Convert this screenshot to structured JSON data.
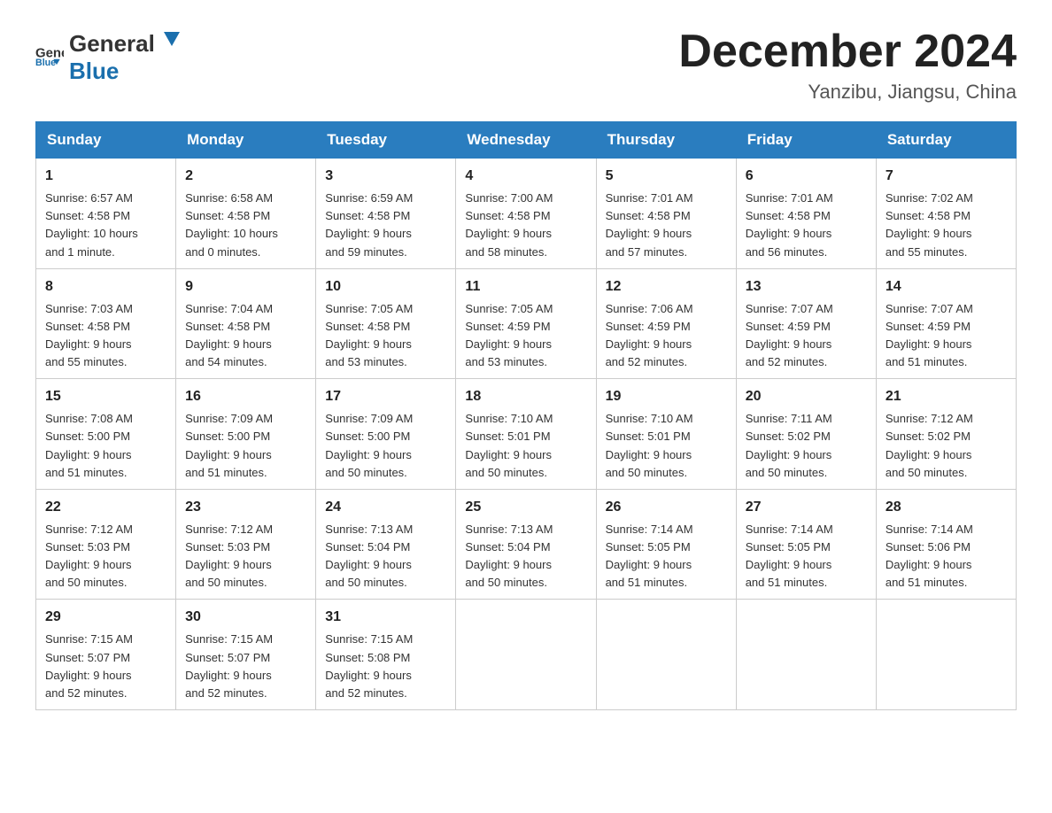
{
  "logo": {
    "text_general": "General",
    "text_blue": "Blue"
  },
  "title": "December 2024",
  "location": "Yanzibu, Jiangsu, China",
  "days_of_week": [
    "Sunday",
    "Monday",
    "Tuesday",
    "Wednesday",
    "Thursday",
    "Friday",
    "Saturday"
  ],
  "weeks": [
    [
      {
        "day": "1",
        "sunrise": "6:57 AM",
        "sunset": "4:58 PM",
        "daylight": "10 hours and 1 minute."
      },
      {
        "day": "2",
        "sunrise": "6:58 AM",
        "sunset": "4:58 PM",
        "daylight": "10 hours and 0 minutes."
      },
      {
        "day": "3",
        "sunrise": "6:59 AM",
        "sunset": "4:58 PM",
        "daylight": "9 hours and 59 minutes."
      },
      {
        "day": "4",
        "sunrise": "7:00 AM",
        "sunset": "4:58 PM",
        "daylight": "9 hours and 58 minutes."
      },
      {
        "day": "5",
        "sunrise": "7:01 AM",
        "sunset": "4:58 PM",
        "daylight": "9 hours and 57 minutes."
      },
      {
        "day": "6",
        "sunrise": "7:01 AM",
        "sunset": "4:58 PM",
        "daylight": "9 hours and 56 minutes."
      },
      {
        "day": "7",
        "sunrise": "7:02 AM",
        "sunset": "4:58 PM",
        "daylight": "9 hours and 55 minutes."
      }
    ],
    [
      {
        "day": "8",
        "sunrise": "7:03 AM",
        "sunset": "4:58 PM",
        "daylight": "9 hours and 55 minutes."
      },
      {
        "day": "9",
        "sunrise": "7:04 AM",
        "sunset": "4:58 PM",
        "daylight": "9 hours and 54 minutes."
      },
      {
        "day": "10",
        "sunrise": "7:05 AM",
        "sunset": "4:58 PM",
        "daylight": "9 hours and 53 minutes."
      },
      {
        "day": "11",
        "sunrise": "7:05 AM",
        "sunset": "4:59 PM",
        "daylight": "9 hours and 53 minutes."
      },
      {
        "day": "12",
        "sunrise": "7:06 AM",
        "sunset": "4:59 PM",
        "daylight": "9 hours and 52 minutes."
      },
      {
        "day": "13",
        "sunrise": "7:07 AM",
        "sunset": "4:59 PM",
        "daylight": "9 hours and 52 minutes."
      },
      {
        "day": "14",
        "sunrise": "7:07 AM",
        "sunset": "4:59 PM",
        "daylight": "9 hours and 51 minutes."
      }
    ],
    [
      {
        "day": "15",
        "sunrise": "7:08 AM",
        "sunset": "5:00 PM",
        "daylight": "9 hours and 51 minutes."
      },
      {
        "day": "16",
        "sunrise": "7:09 AM",
        "sunset": "5:00 PM",
        "daylight": "9 hours and 51 minutes."
      },
      {
        "day": "17",
        "sunrise": "7:09 AM",
        "sunset": "5:00 PM",
        "daylight": "9 hours and 50 minutes."
      },
      {
        "day": "18",
        "sunrise": "7:10 AM",
        "sunset": "5:01 PM",
        "daylight": "9 hours and 50 minutes."
      },
      {
        "day": "19",
        "sunrise": "7:10 AM",
        "sunset": "5:01 PM",
        "daylight": "9 hours and 50 minutes."
      },
      {
        "day": "20",
        "sunrise": "7:11 AM",
        "sunset": "5:02 PM",
        "daylight": "9 hours and 50 minutes."
      },
      {
        "day": "21",
        "sunrise": "7:12 AM",
        "sunset": "5:02 PM",
        "daylight": "9 hours and 50 minutes."
      }
    ],
    [
      {
        "day": "22",
        "sunrise": "7:12 AM",
        "sunset": "5:03 PM",
        "daylight": "9 hours and 50 minutes."
      },
      {
        "day": "23",
        "sunrise": "7:12 AM",
        "sunset": "5:03 PM",
        "daylight": "9 hours and 50 minutes."
      },
      {
        "day": "24",
        "sunrise": "7:13 AM",
        "sunset": "5:04 PM",
        "daylight": "9 hours and 50 minutes."
      },
      {
        "day": "25",
        "sunrise": "7:13 AM",
        "sunset": "5:04 PM",
        "daylight": "9 hours and 50 minutes."
      },
      {
        "day": "26",
        "sunrise": "7:14 AM",
        "sunset": "5:05 PM",
        "daylight": "9 hours and 51 minutes."
      },
      {
        "day": "27",
        "sunrise": "7:14 AM",
        "sunset": "5:05 PM",
        "daylight": "9 hours and 51 minutes."
      },
      {
        "day": "28",
        "sunrise": "7:14 AM",
        "sunset": "5:06 PM",
        "daylight": "9 hours and 51 minutes."
      }
    ],
    [
      {
        "day": "29",
        "sunrise": "7:15 AM",
        "sunset": "5:07 PM",
        "daylight": "9 hours and 52 minutes."
      },
      {
        "day": "30",
        "sunrise": "7:15 AM",
        "sunset": "5:07 PM",
        "daylight": "9 hours and 52 minutes."
      },
      {
        "day": "31",
        "sunrise": "7:15 AM",
        "sunset": "5:08 PM",
        "daylight": "9 hours and 52 minutes."
      },
      null,
      null,
      null,
      null
    ]
  ],
  "labels": {
    "sunrise": "Sunrise:",
    "sunset": "Sunset:",
    "daylight": "Daylight:"
  }
}
